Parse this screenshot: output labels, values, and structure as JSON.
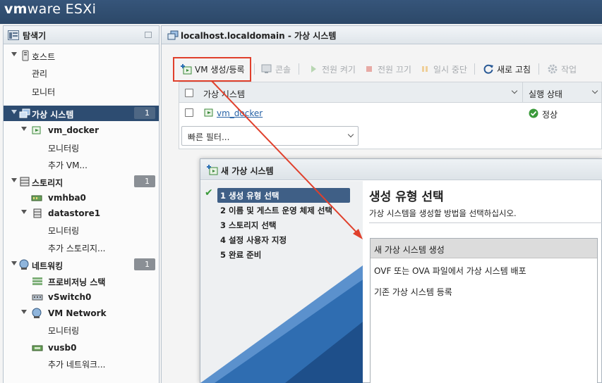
{
  "app": {
    "brand_vm": "vm",
    "brand_rest": "ware ESXi",
    "colors": {
      "topbar": "#2f4d70",
      "selection": "#2d4c71",
      "highlight": "#e0402c",
      "ok_green": "#3a9a3a"
    }
  },
  "navigator": {
    "title": "탐색기",
    "items": [
      {
        "label": "호스트",
        "icon": "host-icon"
      },
      {
        "label": "관리"
      },
      {
        "label": "모니터"
      },
      {
        "label": "가상 시스템",
        "icon": "vm-group-icon",
        "count": "1",
        "selected": true
      },
      {
        "label": "vm_docker",
        "icon": "vm-icon"
      },
      {
        "label": "모니터링"
      },
      {
        "label": "추가 VM..."
      },
      {
        "label": "스토리지",
        "icon": "storage-icon",
        "count": "1"
      },
      {
        "label": "vmhba0",
        "icon": "adapter-icon"
      },
      {
        "label": "datastore1",
        "icon": "datastore-icon"
      },
      {
        "label": "모니터링"
      },
      {
        "label": "추가 스토리지..."
      },
      {
        "label": "네트워킹",
        "icon": "network-icon",
        "count": "1"
      },
      {
        "label": "프로비저닝 스택",
        "icon": "stack-icon"
      },
      {
        "label": "vSwitch0",
        "icon": "switch-icon"
      },
      {
        "label": "VM Network",
        "icon": "portgroup-icon"
      },
      {
        "label": "모니터링"
      },
      {
        "label": "vusb0",
        "icon": "usb-icon"
      },
      {
        "label": "추가 네트워크..."
      }
    ]
  },
  "main": {
    "title": "localhost.localdomain - 가상 시스템",
    "toolbar": {
      "create": "VM 생성/등록",
      "console": "콘솔",
      "power_on": "전원 켜기",
      "power_off": "전원 끄기",
      "suspend": "일시 중단",
      "refresh": "새로 고침",
      "actions": "작업"
    },
    "grid": {
      "columns": [
        "가상 시스템",
        "실행 상태"
      ],
      "rows": [
        {
          "name": "vm_docker",
          "status": "정상"
        }
      ],
      "filter_placeholder": "빠른 필터..."
    }
  },
  "wizard": {
    "title": "새 가상 시스템",
    "steps": [
      "1 생성 유형 선택",
      "2 이름 및 게스트 운영 체제 선택",
      "3 스토리지 선택",
      "4 설정 사용자 지정",
      "5 완료 준비"
    ],
    "current_step": 0,
    "heading": "생성 유형 선택",
    "description": "가상 시스템을 생성할 방법을 선택하십시오.",
    "options": [
      "새 가상 시스템 생성",
      "OVF 또는 OVA 파일에서 가상 시스템 배포",
      "기존 가상 시스템 등록"
    ],
    "selected_option": 0
  }
}
